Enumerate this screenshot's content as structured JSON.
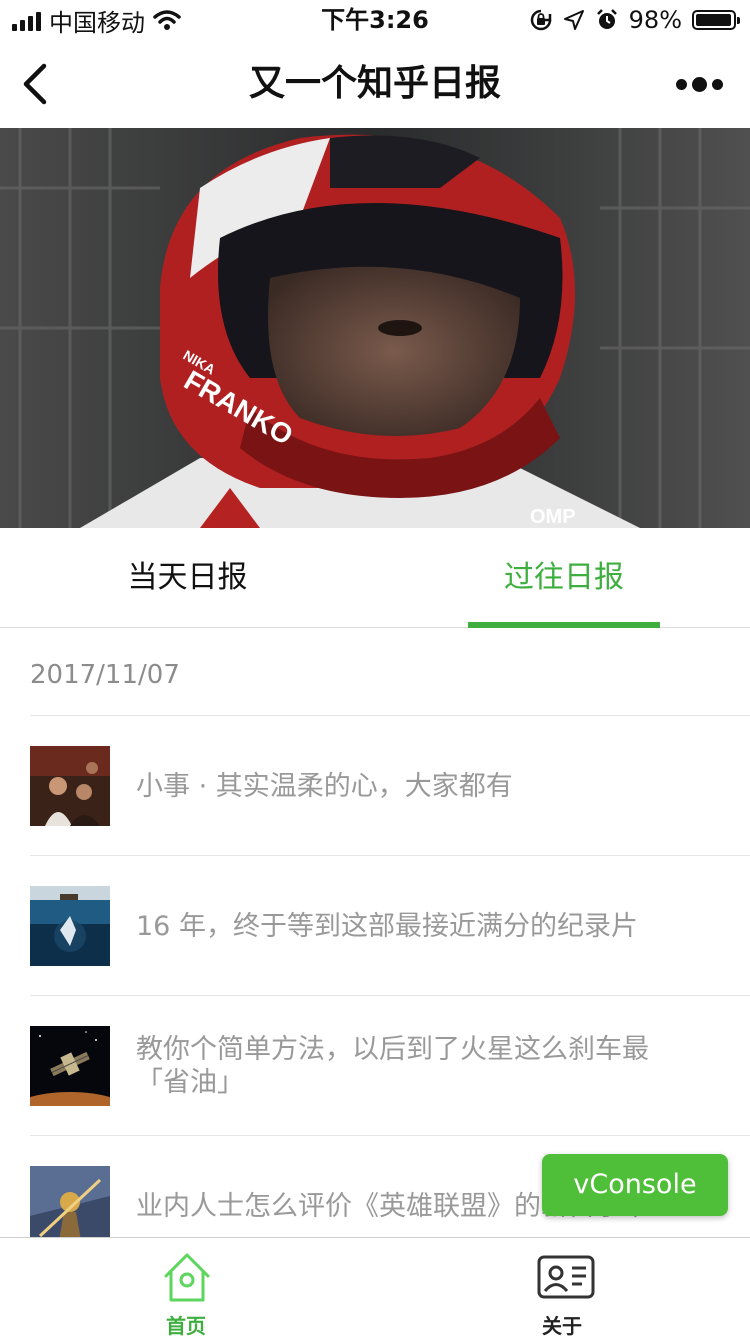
{
  "status_bar": {
    "carrier": "中国移动",
    "time": "下午3:26",
    "battery_text": "98%",
    "battery_level": 0.98
  },
  "nav": {
    "title": "又一个知乎日报",
    "back_icon": "chevron-left-icon",
    "more_icon": "more-dots-icon"
  },
  "hero": {
    "helmet_text_1": "NIKA",
    "helmet_text_2": "FRANKO",
    "brand_text": "OMP"
  },
  "tabs": [
    {
      "label": "当天日报",
      "active": false
    },
    {
      "label": "过往日报",
      "active": true
    }
  ],
  "date": "2017/11/07",
  "articles": [
    {
      "title": "小事 · 其实温柔的心，大家都有"
    },
    {
      "title": "16 年，终于等到这部最接近满分的纪录片"
    },
    {
      "title": "教你个简单方法，以后到了火星这么刹车最「省油」"
    },
    {
      "title": "业内人士怎么评价《英雄联盟》的新自学干"
    }
  ],
  "vconsole_label": "vConsole",
  "tabbar": {
    "home_label": "首页",
    "about_label": "关于"
  },
  "colors": {
    "accent": "#3eaf3e",
    "vconsole": "#4fbf3a",
    "muted_text": "#999999"
  }
}
